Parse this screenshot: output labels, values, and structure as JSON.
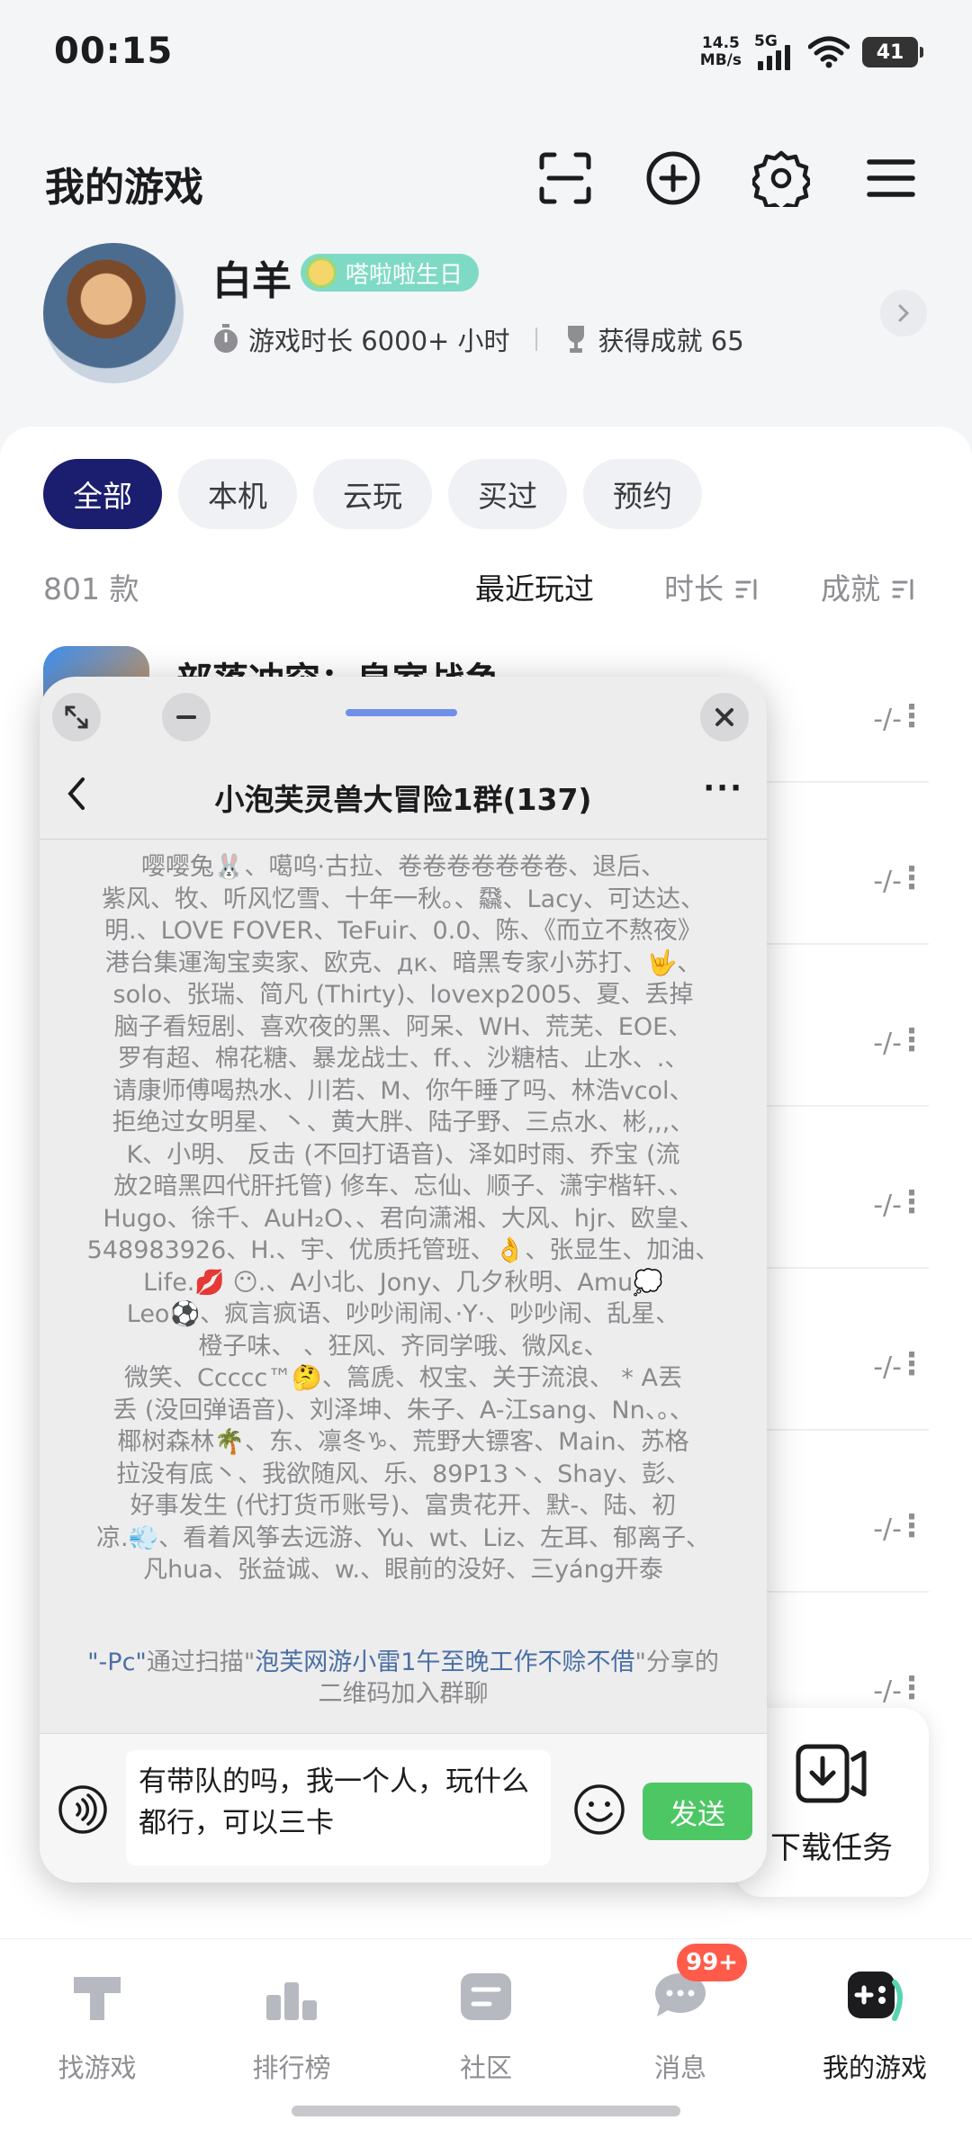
{
  "status_bar": {
    "time": "00:15",
    "net_speed_value": "14.5",
    "net_speed_unit": "MB/s",
    "network": "5G",
    "battery": "41"
  },
  "header": {
    "title": "我的游戏"
  },
  "profile": {
    "name": "白羊",
    "badge": "嗒啦啦生日",
    "playtime": "游戏时长 6000+ 小时",
    "achievements": "获得成就 65"
  },
  "tabs": [
    "全部",
    "本机",
    "云玩",
    "买过",
    "预约"
  ],
  "list": {
    "count": "801 款",
    "sort": {
      "recent": "最近玩过",
      "duration": "时长",
      "achievement": "成就"
    },
    "first_game_title": "部落冲突：皇室战争",
    "row_meta": [
      "-/-",
      "-/-",
      "-/-",
      "-/-",
      "-/-",
      "-/-",
      "-/-"
    ]
  },
  "chat": {
    "title": "小泡芙灵兽大冒险1群(137)",
    "member_lines": [
      "嘤嘤兔🐰、噶呜·古拉、卷卷卷卷卷卷卷、退后、",
      "紫风、牧、听风忆雪、十年一秋。、飝、Lacy、可达达、",
      "明.、LOVE FOVER、TeFuir、0.0、陈、《而立不熬夜》",
      "港台集運淘宝卖家、欧克、дк、暗黑专家小苏打、🤟、",
      "solo、张瑞、简凡 (Thirty)、lovexp2005、夏、丢掉",
      "脑子看短剧、喜欢夜的黑、阿呆、WH、荒芜、EOE、",
      "罗有超、棉花糖、暴龙战士、ff、、沙糖桔、止水、.、",
      "请康师傅喝热水、川若、M、你午睡了吗、林浩vcol、",
      "拒绝过女明星、丶、黄大胖、陆子野、三点水、彬,,,、",
      "K、小明、  反击 (不回打语音)、泽如时雨、乔宝 (流",
      "放2暗黑四代肝托管) 修车、忘仙、顺子、潇宇楷轩、、",
      "Hugo、徐千、AuH₂O、、君向潇湘、大风、hjr、欧皇、",
      "548983926、H.、宇、优质托管班、👌、张显生、加油、",
      "Life.💋         😶.、A小北、Jony、几夕秋明、Amu💭",
      "Leo⚽、疯言疯语、吵吵闹闹、·Y·、吵吵闹、乱星、",
      "橙子味、                          、狂风、齐同学哦、微风ε、",
      "微笑、Ccccc™🤔、篙虒、权宝、关于流浪、 *  A丟",
      "丢 (没回弹语音)、刘泽坤、朱子、A-江sang、Nn、。、",
      "椰树森林🌴、东、凛冬♑、荒野大镖客、Main、苏格",
      "拉没有底丶、我欲随风、乐、89P13丶、Shay、彭、",
      "好事发生 (代打货币账号)、富贵花开、默-、陆、初",
      "凉.💨、看着风筝去远游、Yu、wt、Liz、左耳、郁离子、",
      "凡hua、张益诚、w.、眼前的没好、三yáng开泰"
    ],
    "join_note": {
      "user": "\"-Pc\"",
      "mid": "通过扫描\"",
      "inviter": "泡芙网游小雷1午至晚工作不赊不借",
      "tail": "\"分享的二维码加入群聊"
    },
    "input_text": "有带队的吗，我一个人，玩什么都行，可以三卡",
    "send_label": "发送"
  },
  "download_widget": {
    "label": "下载任务"
  },
  "bottom_nav": {
    "items": [
      "找游戏",
      "排行榜",
      "社区",
      "消息",
      "我的游戏"
    ],
    "message_badge": "99+"
  },
  "colors": {
    "accent": "#1b1e6e",
    "send": "#4cc764",
    "badge": "#7fdac5",
    "alert": "#ff5a4a"
  }
}
